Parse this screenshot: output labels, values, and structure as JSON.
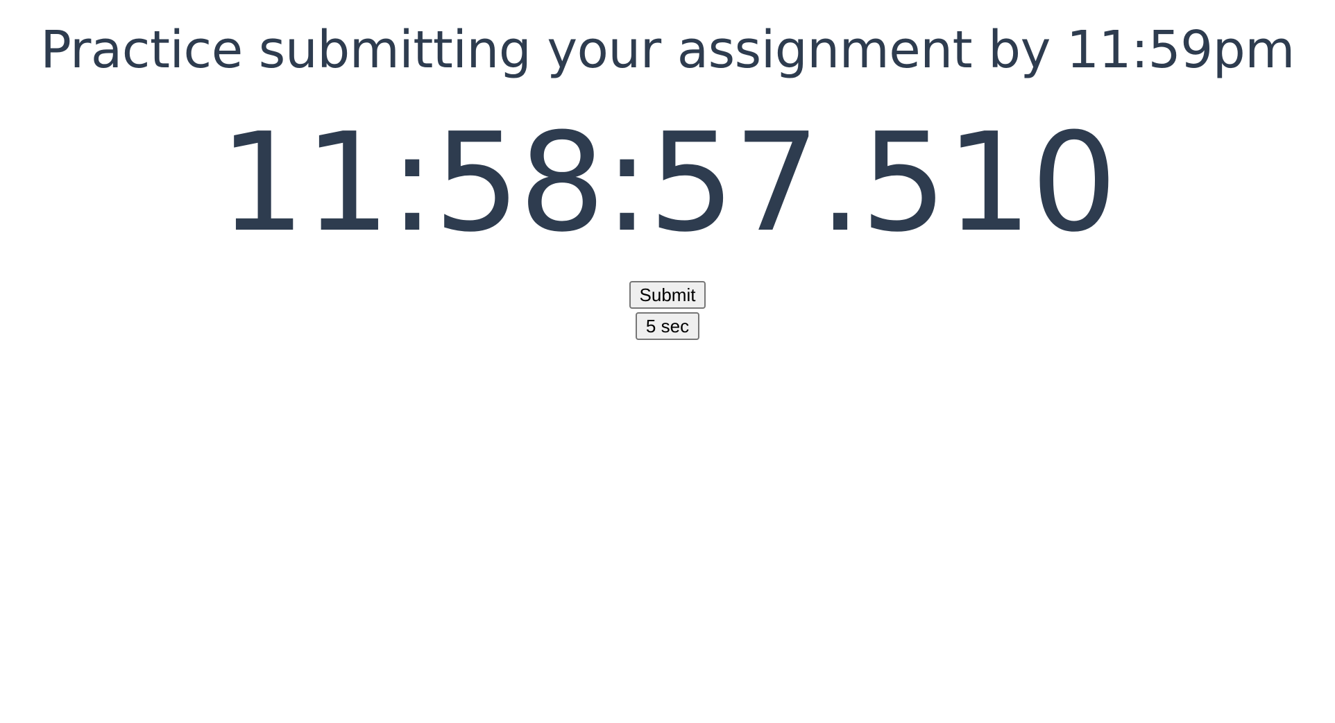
{
  "header": {
    "title": "Practice submitting your assignment by 11:59pm"
  },
  "clock": {
    "time": "11:58:57.510"
  },
  "actions": {
    "submit_label": "Submit",
    "timer_label": "5 sec"
  },
  "colors": {
    "text": "#2e3c4f",
    "button_bg": "#efefef",
    "button_border": "#767676"
  }
}
